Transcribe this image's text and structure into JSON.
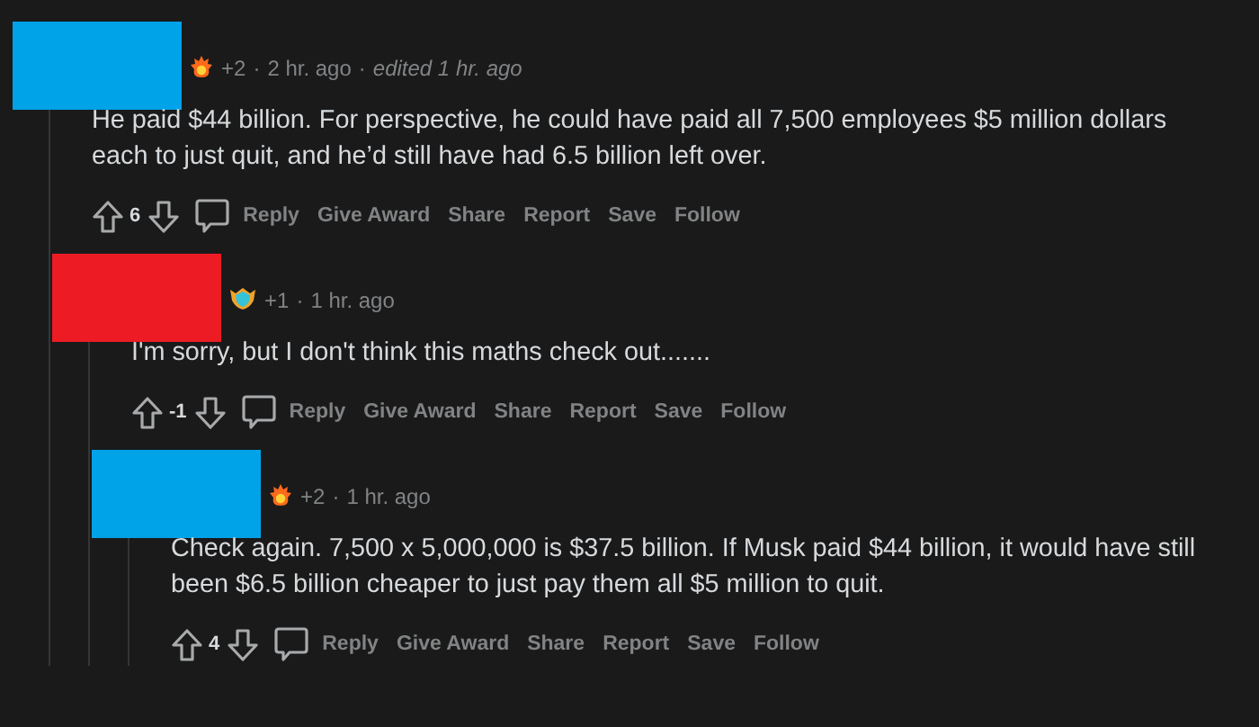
{
  "comments": [
    {
      "redaction": {
        "color": "#00a2e8"
      },
      "award": {
        "kind": "fire"
      },
      "award_count": "+2",
      "separator": "·",
      "time": "2 hr. ago",
      "edited": "edited 1 hr. ago",
      "body_lines": [
        "He paid $44 billion. For perspective, he could have paid all 7,500 employees $5 million dollars",
        "each to just quit, and he’d still have had 6.5 billion left over."
      ],
      "score": "6",
      "actions": [
        "Reply",
        "Give Award",
        "Share",
        "Report",
        "Save",
        "Follow"
      ],
      "children": [
        {
          "redaction": {
            "color": "#ed1c24"
          },
          "award": {
            "kind": "shield"
          },
          "award_count": "+1",
          "separator": "·",
          "time": "1 hr. ago",
          "body_lines": [
            "I'm sorry, but I don't think this maths check out......."
          ],
          "score": "-1",
          "actions": [
            "Reply",
            "Give Award",
            "Share",
            "Report",
            "Save",
            "Follow"
          ],
          "children": [
            {
              "redaction": {
                "color": "#00a2e8"
              },
              "award": {
                "kind": "fire"
              },
              "award_count": "+2",
              "separator": "·",
              "time": "1 hr. ago",
              "body_lines": [
                "Check again. 7,500 x 5,000,000 is $37.5 billion. If Musk paid $44 billion, it would have still",
                "been $6.5 billion cheaper to just pay them all $5 million to quit."
              ],
              "score": "4",
              "actions": [
                "Reply",
                "Give Award",
                "Share",
                "Report",
                "Save",
                "Follow"
              ]
            }
          ]
        }
      ]
    }
  ]
}
